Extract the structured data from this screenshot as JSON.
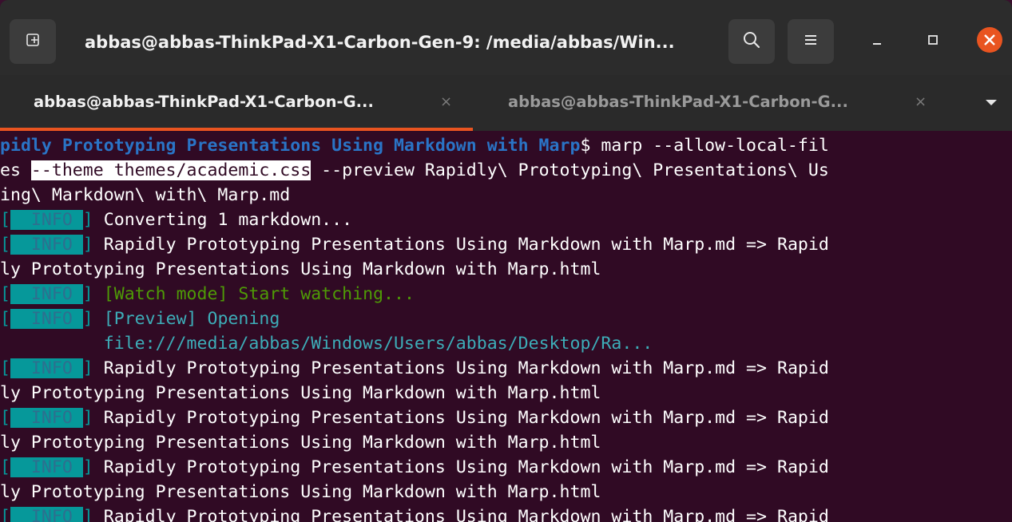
{
  "window": {
    "title": "abbas@abbas-ThinkPad-X1-Carbon-Gen-9: /media/abbas/Win...",
    "new_tab_icon": "new-tab-icon",
    "search_icon": "search-icon",
    "menu_icon": "hamburger-menu-icon",
    "minimize_icon": "minimize-icon",
    "maximize_icon": "maximize-icon",
    "close_icon": "close-icon",
    "close_color": "#e95420"
  },
  "tabs": [
    {
      "label": "abbas@abbas-ThinkPad-X1-Carbon-G...",
      "close": "×",
      "active": true
    },
    {
      "label": "abbas@abbas-ThinkPad-X1-Carbon-G...",
      "close": "×",
      "active": false
    }
  ],
  "tab_dropdown_icon": "chevron-down-icon",
  "terminal": {
    "prompt_path": "pidly Prototyping Presentations Using Markdown with Marp",
    "prompt_symbol": "$",
    "cmd_part1": " marp --allow-local-fil",
    "cmd_part2_prefix": "es ",
    "cmd_highlight": "--theme themes/academic.css",
    "cmd_part2_suffix": " --preview Rapidly\\ Prototyping\\ Presentations\\ Us",
    "cmd_part3": "ing\\ Markdown\\ with\\ Marp.md",
    "info_bracket_open": "[",
    "info_tag": "  INFO ",
    "info_bracket_close": "]",
    "msg_converting": "Converting 1 markdown...",
    "msg_render_a": "Rapidly Prototyping Presentations Using Markdown with Marp.md => Rapid",
    "msg_render_b": "ly Prototyping Presentations Using Markdown with Marp.html",
    "msg_watch": "[Watch mode] Start watching...",
    "msg_preview": "[Preview] Opening",
    "msg_preview_url": "file:///media/abbas/Windows/Users/abbas/Desktop/Ra...",
    "msg_last_partial": "Rapidly Prototyping Presentations Using Markdown with Marp.md => Rapid"
  }
}
